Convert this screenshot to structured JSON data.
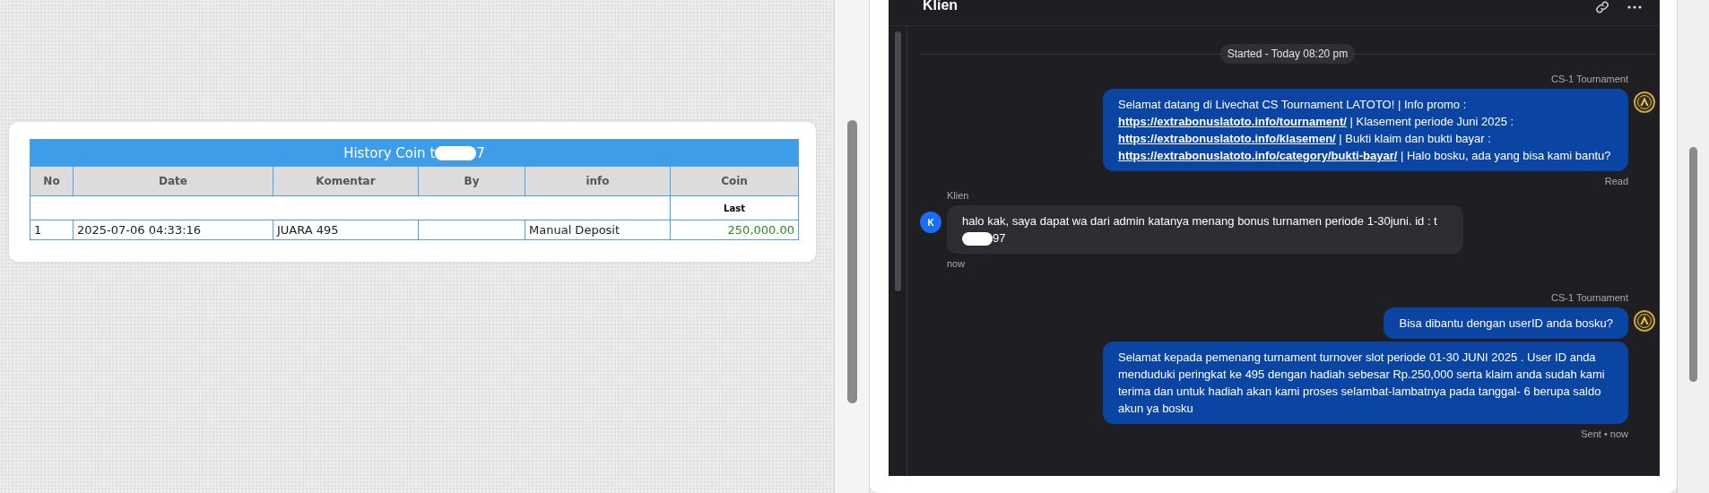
{
  "history": {
    "title_start": "History Coin t",
    "title_end": "7",
    "columns": [
      "No",
      "Date",
      "Komentar",
      "By",
      "info",
      "Coin"
    ],
    "subheader": {
      "coin": "Last"
    },
    "rows": [
      {
        "no": "1",
        "date": "2025-07-06 04:33:16",
        "komentar": "JUARA 495",
        "info": "Manual Deposit",
        "coin": "250,000.00"
      }
    ]
  },
  "chat": {
    "title": "Klien",
    "messages": [
      {
        "kind": "divider",
        "text": "Started - Today 08:20 pm"
      },
      {
        "kind": "agent",
        "sender": "CS-1 Tournament",
        "status": "Read",
        "bubbles": [
          {
            "segments": [
              {
                "kind": "text",
                "text": "Selamat datang di Livechat CS Tournament LATOTO! | Info promo : "
              },
              {
                "kind": "link",
                "text": "https://extrabonuslatoto.info/tournament/"
              },
              {
                "kind": "text",
                "text": " | Klasement periode Juni 2025 : "
              },
              {
                "kind": "link",
                "text": "https://extrabonuslatoto.info/klasemen/"
              },
              {
                "kind": "text",
                "text": " | Bukti klaim dan bukti bayar : "
              },
              {
                "kind": "link",
                "text": "https://extrabonuslatoto.info/category/bukti-bayar/"
              },
              {
                "kind": "text",
                "text": " | Halo bosku, ada yang bisa kami bantu?"
              }
            ]
          }
        ]
      },
      {
        "kind": "client",
        "sender": "Klien",
        "avatar": "K",
        "status": "now",
        "bubbles": [
          {
            "segments": [
              {
                "kind": "text",
                "text": "halo kak, saya dapat wa dari admin katanya menang bonus turnamen periode 1-30juni. id : t"
              },
              {
                "kind": "redaction"
              },
              {
                "kind": "text",
                "text": "97"
              }
            ]
          }
        ]
      },
      {
        "kind": "agent",
        "sender": "CS-1 Tournament",
        "status": "Sent • now",
        "bubbles": [
          {
            "segments": [
              {
                "kind": "text",
                "text": "Bisa dibantu dengan userID anda bosku?"
              }
            ]
          },
          {
            "segments": [
              {
                "kind": "text",
                "text": "Selamat kepada pemenang turnament turnover slot periode 01-30 JUNI 2025 . User ID anda menduduki peringkat ke 495 dengan hadiah sebesar Rp.250,000 serta klaim anda sudah kami terima dan untuk hadiah akan kami proses selambat-lambatnya pada tanggal- 6 berupa saldo akun ya bosku"
              }
            ]
          }
        ]
      }
    ]
  }
}
